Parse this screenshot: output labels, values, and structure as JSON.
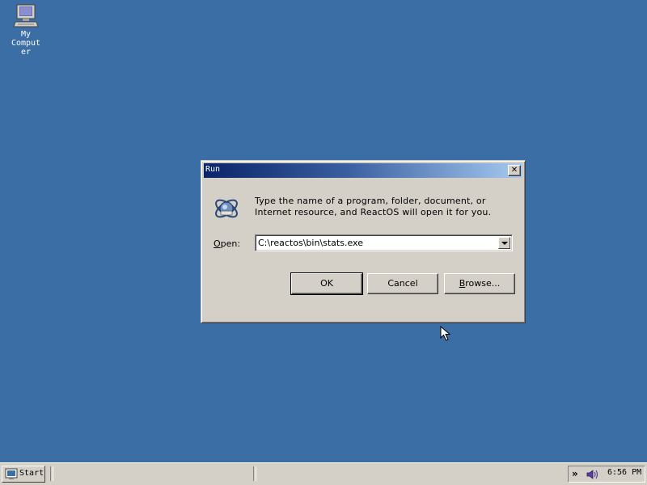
{
  "desktop": {
    "background_color": "#3a6ea5",
    "icons": [
      {
        "label": "My Computer",
        "icon": "computer-icon"
      }
    ]
  },
  "dialog": {
    "title": "Run",
    "close_symbol": "✕",
    "run_icon": "run-program-icon",
    "prompt": "Type the name of a program, folder, document, or Internet resource, and ReactOS will open it for you.",
    "open_label_mnemonic": "O",
    "open_label_rest": "pen:",
    "open_value": "C:\\reactos\\bin\\stats.exe",
    "buttons": {
      "ok": "OK",
      "cancel": "Cancel",
      "browse_mnemonic": "B",
      "browse_rest": "rowse..."
    }
  },
  "taskbar": {
    "start_label": "Start",
    "start_icon": "reactos-start-icon",
    "tray": {
      "chevron": "»",
      "volume_icon": "speaker-icon",
      "clock": "6:56 PM"
    }
  },
  "colors": {
    "title_gradient_start": "#0a246a",
    "title_gradient_end": "#a6caf0",
    "face": "#d4d0c8"
  }
}
